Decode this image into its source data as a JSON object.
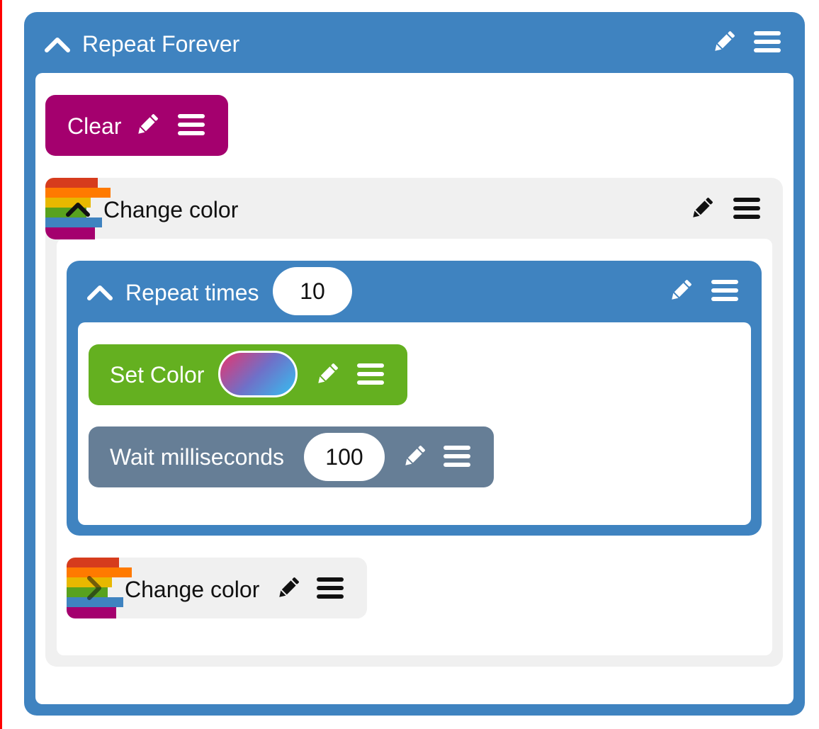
{
  "repeat_forever": {
    "label": "Repeat Forever",
    "color": "#3f83c0",
    "icons": [
      "chevron-up-icon",
      "pencil-icon",
      "menu-icon"
    ]
  },
  "clear": {
    "label": "Clear",
    "color": "#a4006e"
  },
  "change_color_expanded": {
    "label": "Change color",
    "background": "#f0f0f0",
    "stripe_colors": [
      "#d63c1d",
      "#ff7a00",
      "#e8b800",
      "#58a21e",
      "#3f83c0",
      "#a4006e"
    ]
  },
  "repeat_times": {
    "label": "Repeat times",
    "value": "10",
    "color": "#3f83c0"
  },
  "set_color": {
    "label": "Set Color",
    "color": "#64b020",
    "swatch_gradient": [
      "#e8336d",
      "#6f70c8",
      "#35bff0"
    ]
  },
  "wait": {
    "label": "Wait milliseconds",
    "value": "100",
    "color": "#667e96"
  },
  "change_color_collapsed": {
    "label": "Change color",
    "background": "#f0f0f0"
  }
}
